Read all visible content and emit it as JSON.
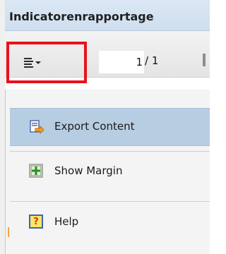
{
  "window": {
    "title": "Indicatorenrapportage"
  },
  "toolbar": {
    "menu_icon": "menu-lines-icon",
    "page_current": "1",
    "page_separator_total": "/ 1"
  },
  "menu": {
    "items": [
      {
        "label": "Export Content",
        "icon": "export-icon",
        "selected": true
      },
      {
        "label": "Show Margin",
        "icon": "margin-icon",
        "selected": false
      },
      {
        "label": "Help",
        "icon": "help-icon",
        "selected": false
      }
    ]
  },
  "colors": {
    "highlight_border": "#e8121b",
    "selected_item": "#b7cde2",
    "title_bar": "#d4e2f1"
  }
}
